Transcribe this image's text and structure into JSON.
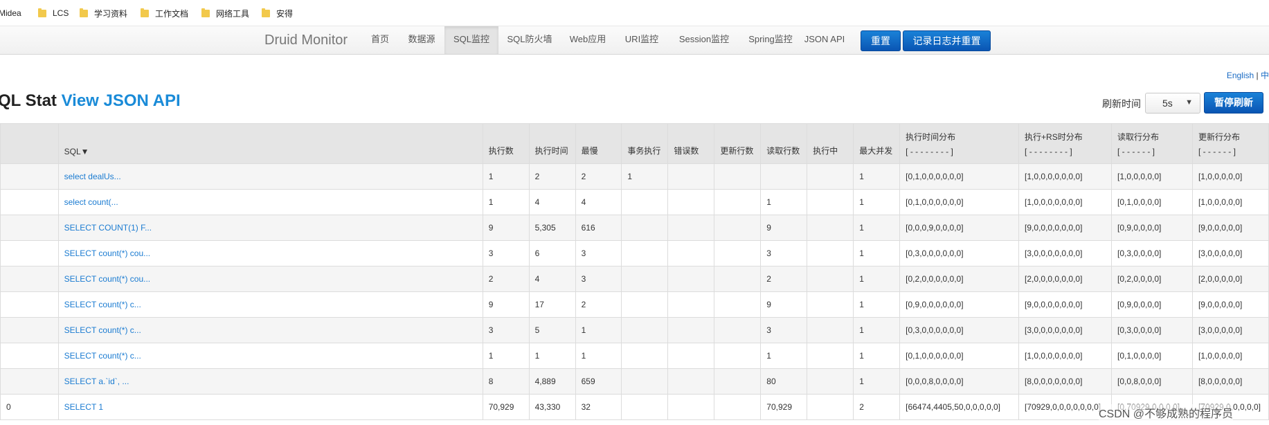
{
  "bookmarks": [
    {
      "label": "Midea",
      "folder": false
    },
    {
      "label": "LCS",
      "folder": true
    },
    {
      "label": "学习资料",
      "folder": true
    },
    {
      "label": "工作文档",
      "folder": true
    },
    {
      "label": "网络工具",
      "folder": true
    },
    {
      "label": "安得",
      "folder": true
    }
  ],
  "navbar": {
    "brand": "Druid Monitor",
    "items": [
      "首页",
      "数据源",
      "SQL监控",
      "SQL防火墙",
      "Web应用",
      "URI监控",
      "Session监控",
      "Spring监控",
      "JSON API"
    ],
    "active_item": "SQL监控",
    "reset_button": "重置",
    "log_reset_button": "记录日志并重置"
  },
  "lang": {
    "english": "English",
    "separator": "|",
    "chinese": "中"
  },
  "title": {
    "prefix": "QL Stat",
    "link": "View JSON API"
  },
  "refresh": {
    "label": "刷新时间",
    "value": "5s",
    "pause_button": "暂停刷新"
  },
  "table": {
    "headers": {
      "sql": "SQL▼",
      "exec_count": "执行数",
      "exec_time": "执行时间",
      "slowest": "最慢",
      "txn": "事务执行",
      "errors": "错误数",
      "update_rows": "更新行数",
      "read_rows": "读取行数",
      "running": "执行中",
      "max_concurrent": "最大并发",
      "exec_dist": "执行时间分布",
      "exec_dist_sub": "[ - - - - - - - - ]",
      "exec_rs_dist": "执行+RS时分布",
      "exec_rs_dist_sub": "[ - - - - - - - - ]",
      "read_dist": "读取行分布",
      "read_dist_sub": "[ - - - - - - ]",
      "update_dist": "更新行分布",
      "update_dist_sub": "[ - - - - - - ]"
    },
    "rows": [
      {
        "id": "",
        "sql": "select dealUs...",
        "exec_count": "1",
        "exec_time": "2",
        "slowest": "2",
        "txn": "1",
        "errors": "",
        "update_rows": "",
        "read_rows": "",
        "running": "",
        "max_concurrent": "1",
        "exec_dist": "[0,1,0,0,0,0,0,0]",
        "exec_rs_dist": "[1,0,0,0,0,0,0,0]",
        "read_dist": "[1,0,0,0,0,0]",
        "update_dist": "[1,0,0,0,0,0]"
      },
      {
        "id": "",
        "sql": "select count(...",
        "exec_count": "1",
        "exec_time": "4",
        "slowest": "4",
        "txn": "",
        "errors": "",
        "update_rows": "",
        "read_rows": "1",
        "running": "",
        "max_concurrent": "1",
        "exec_dist": "[0,1,0,0,0,0,0,0]",
        "exec_rs_dist": "[1,0,0,0,0,0,0,0]",
        "read_dist": "[0,1,0,0,0,0]",
        "update_dist": "[1,0,0,0,0,0]"
      },
      {
        "id": "",
        "sql": "SELECT COUNT(1) F...",
        "exec_count": "9",
        "exec_time": "5,305",
        "slowest": "616",
        "txn": "",
        "errors": "",
        "update_rows": "",
        "read_rows": "9",
        "running": "",
        "max_concurrent": "1",
        "exec_dist": "[0,0,0,9,0,0,0,0]",
        "exec_rs_dist": "[9,0,0,0,0,0,0,0]",
        "read_dist": "[0,9,0,0,0,0]",
        "update_dist": "[9,0,0,0,0,0]"
      },
      {
        "id": "",
        "sql": "SELECT count(*) cou...",
        "exec_count": "3",
        "exec_time": "6",
        "slowest": "3",
        "txn": "",
        "errors": "",
        "update_rows": "",
        "read_rows": "3",
        "running": "",
        "max_concurrent": "1",
        "exec_dist": "[0,3,0,0,0,0,0,0]",
        "exec_rs_dist": "[3,0,0,0,0,0,0,0]",
        "read_dist": "[0,3,0,0,0,0]",
        "update_dist": "[3,0,0,0,0,0]"
      },
      {
        "id": "",
        "sql": "SELECT count(*) cou...",
        "exec_count": "2",
        "exec_time": "4",
        "slowest": "3",
        "txn": "",
        "errors": "",
        "update_rows": "",
        "read_rows": "2",
        "running": "",
        "max_concurrent": "1",
        "exec_dist": "[0,2,0,0,0,0,0,0]",
        "exec_rs_dist": "[2,0,0,0,0,0,0,0]",
        "read_dist": "[0,2,0,0,0,0]",
        "update_dist": "[2,0,0,0,0,0]"
      },
      {
        "id": "",
        "sql": "SELECT count(*) c...",
        "exec_count": "9",
        "exec_time": "17",
        "slowest": "2",
        "txn": "",
        "errors": "",
        "update_rows": "",
        "read_rows": "9",
        "running": "",
        "max_concurrent": "1",
        "exec_dist": "[0,9,0,0,0,0,0,0]",
        "exec_rs_dist": "[9,0,0,0,0,0,0,0]",
        "read_dist": "[0,9,0,0,0,0]",
        "update_dist": "[9,0,0,0,0,0]"
      },
      {
        "id": "",
        "sql": "SELECT count(*) c...",
        "exec_count": "3",
        "exec_time": "5",
        "slowest": "1",
        "txn": "",
        "errors": "",
        "update_rows": "",
        "read_rows": "3",
        "running": "",
        "max_concurrent": "1",
        "exec_dist": "[0,3,0,0,0,0,0,0]",
        "exec_rs_dist": "[3,0,0,0,0,0,0,0]",
        "read_dist": "[0,3,0,0,0,0]",
        "update_dist": "[3,0,0,0,0,0]"
      },
      {
        "id": "",
        "sql": "SELECT count(*) c...",
        "exec_count": "1",
        "exec_time": "1",
        "slowest": "1",
        "txn": "",
        "errors": "",
        "update_rows": "",
        "read_rows": "1",
        "running": "",
        "max_concurrent": "1",
        "exec_dist": "[0,1,0,0,0,0,0,0]",
        "exec_rs_dist": "[1,0,0,0,0,0,0,0]",
        "read_dist": "[0,1,0,0,0,0]",
        "update_dist": "[1,0,0,0,0,0]"
      },
      {
        "id": "",
        "sql": "SELECT a.`id`, ...",
        "exec_count": "8",
        "exec_time": "4,889",
        "slowest": "659",
        "txn": "",
        "errors": "",
        "update_rows": "",
        "read_rows": "80",
        "running": "",
        "max_concurrent": "1",
        "exec_dist": "[0,0,0,8,0,0,0,0]",
        "exec_rs_dist": "[8,0,0,0,0,0,0,0]",
        "read_dist": "[0,0,8,0,0,0]",
        "update_dist": "[8,0,0,0,0,0]"
      },
      {
        "id": "0",
        "sql": "SELECT 1",
        "exec_count": "70,929",
        "exec_time": "43,330",
        "slowest": "32",
        "txn": "",
        "errors": "",
        "update_rows": "",
        "read_rows": "70,929",
        "running": "",
        "max_concurrent": "2",
        "exec_dist": "[66474,4405,50,0,0,0,0,0]",
        "exec_rs_dist": "[70929,0,0,0,0,0,0,0]",
        "read_dist": "[0,70929,0,0,0,0]",
        "update_dist": "[70929,0,0,0,0,0]"
      }
    ]
  },
  "watermark_text": "CSDN @不够成熟的程序员"
}
